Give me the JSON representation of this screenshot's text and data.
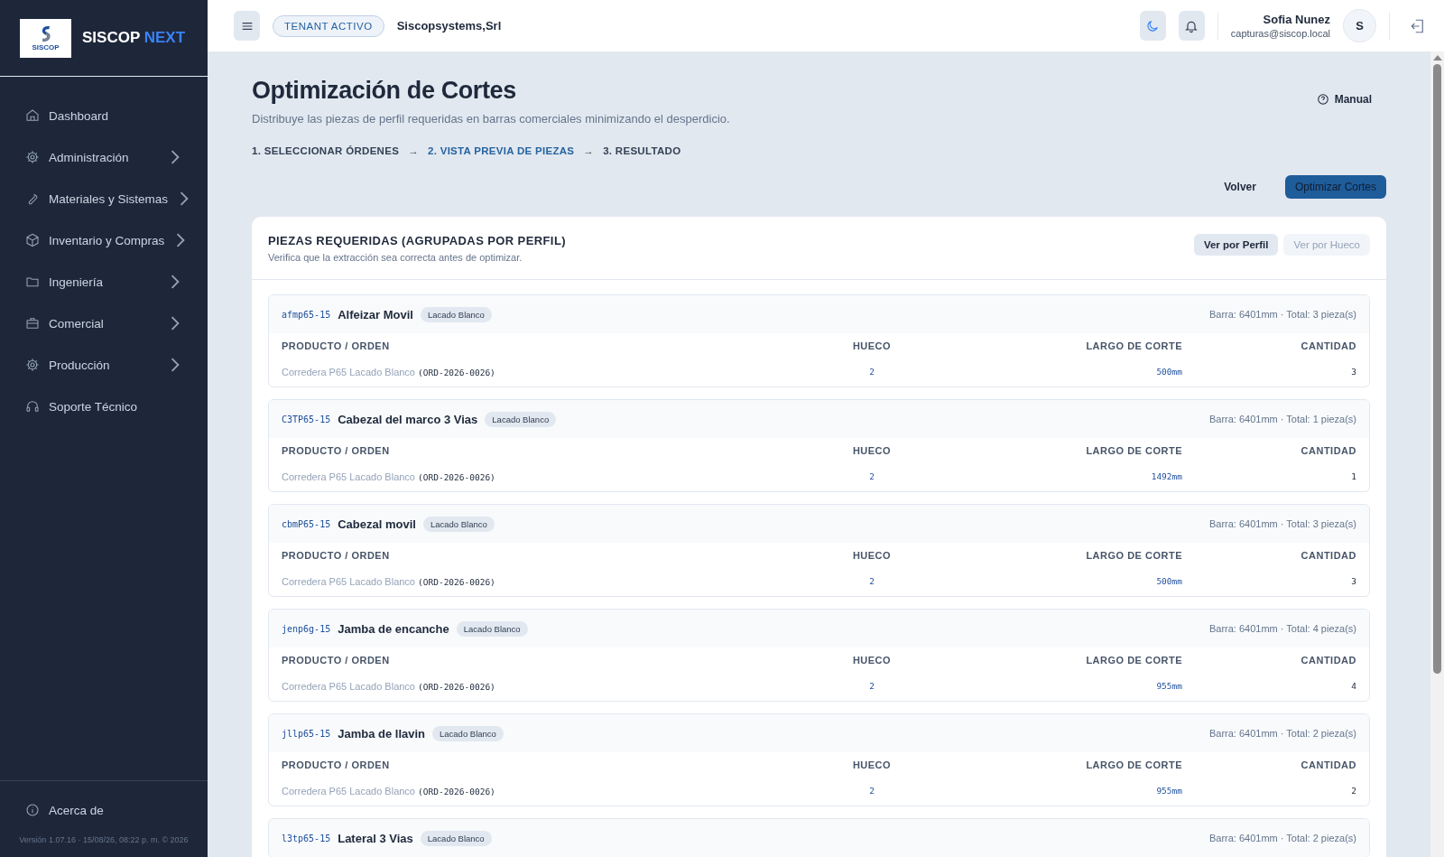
{
  "sidebar": {
    "logo_text": "SISCOP",
    "logo_accent": "NEXT",
    "logo_caption": "SISCOP",
    "items": [
      {
        "label": "Dashboard",
        "submenu": false
      },
      {
        "label": "Administración",
        "submenu": true
      },
      {
        "label": "Materiales y Sistemas",
        "submenu": true
      },
      {
        "label": "Inventario y Compras",
        "submenu": true
      },
      {
        "label": "Ingeniería",
        "submenu": true
      },
      {
        "label": "Comercial",
        "submenu": true
      },
      {
        "label": "Producción",
        "submenu": true
      },
      {
        "label": "Soporte Técnico",
        "submenu": false
      }
    ],
    "footer_item": {
      "label": "Acerca de"
    },
    "version": "Versión 1.07.16 · 15/08/26, 08:22 p. m. © 2026"
  },
  "header": {
    "tenant_badge": "TENANT ACTIVO",
    "tenant_name": "Siscopsystems,Srl",
    "user_name": "Sofia Nunez",
    "user_email": "capturas@siscop.local",
    "avatar": "S"
  },
  "page": {
    "title": "Optimización de Cortes",
    "subtitle": "Distribuye las piezas de perfil requeridas en barras comerciales minimizando el desperdicio.",
    "manual": "Manual",
    "steps": [
      {
        "label": "1. SELECCIONAR ÓRDENES",
        "selected": false
      },
      {
        "label": "2. VISTA PREVIA DE PIEZAS",
        "selected": true
      },
      {
        "label": "3. RESULTADO",
        "selected": false
      }
    ],
    "step_separators": [
      "→",
      "→"
    ],
    "back_button": "Volver",
    "primary_button": "Optimizar Cortes"
  },
  "card": {
    "title": "PIEZAS REQUERIDAS (AGRUPADAS POR PERFIL)",
    "subtitle": "Verifica que la extracción sea correcta antes de optimizar.",
    "view_toggle": [
      {
        "label": "Ver por Perfil",
        "selected": true
      },
      {
        "label": "Ver por Hueco",
        "selected": false
      }
    ],
    "groups": [
      {
        "code": "afmp65-15",
        "name": "Alfeizar Movil",
        "tag": "Lacado Blanco",
        "summary": "Barra: 6401mm · Total: 3 pieza(s)",
        "columns": [
          "PRODUCTO / ORDEN",
          "HUECO",
          "LARGO DE CORTE",
          "CANTIDAD"
        ],
        "rows": [
          {
            "product": "Corredera P65 Lacado Blanco",
            "order": "(ORD-2026-0026)",
            "hueco": "2",
            "largo": "500mm",
            "cantidad": "3"
          }
        ]
      },
      {
        "code": "C3TP65-15",
        "name": "Cabezal del marco 3 Vias",
        "tag": "Lacado Blanco",
        "summary": "Barra: 6401mm · Total: 1 pieza(s)",
        "columns": [
          "PRODUCTO / ORDEN",
          "HUECO",
          "LARGO DE CORTE",
          "CANTIDAD"
        ],
        "rows": [
          {
            "product": "Corredera P65 Lacado Blanco",
            "order": "(ORD-2026-0026)",
            "hueco": "2",
            "largo": "1492mm",
            "cantidad": "1"
          }
        ]
      },
      {
        "code": "cbmP65-15",
        "name": "Cabezal movil",
        "tag": "Lacado Blanco",
        "summary": "Barra: 6401mm · Total: 3 pieza(s)",
        "columns": [
          "PRODUCTO / ORDEN",
          "HUECO",
          "LARGO DE CORTE",
          "CANTIDAD"
        ],
        "rows": [
          {
            "product": "Corredera P65 Lacado Blanco",
            "order": "(ORD-2026-0026)",
            "hueco": "2",
            "largo": "500mm",
            "cantidad": "3"
          }
        ]
      },
      {
        "code": "jenp6g-15",
        "name": "Jamba de encanche",
        "tag": "Lacado Blanco",
        "summary": "Barra: 6401mm · Total: 4 pieza(s)",
        "columns": [
          "PRODUCTO / ORDEN",
          "HUECO",
          "LARGO DE CORTE",
          "CANTIDAD"
        ],
        "rows": [
          {
            "product": "Corredera P65 Lacado Blanco",
            "order": "(ORD-2026-0026)",
            "hueco": "2",
            "largo": "955mm",
            "cantidad": "4"
          }
        ]
      },
      {
        "code": "jllp65-15",
        "name": "Jamba de llavin",
        "tag": "Lacado Blanco",
        "summary": "Barra: 6401mm · Total: 2 pieza(s)",
        "columns": [
          "PRODUCTO / ORDEN",
          "HUECO",
          "LARGO DE CORTE",
          "CANTIDAD"
        ],
        "rows": [
          {
            "product": "Corredera P65 Lacado Blanco",
            "order": "(ORD-2026-0026)",
            "hueco": "2",
            "largo": "955mm",
            "cantidad": "2"
          }
        ]
      },
      {
        "code": "l3tp65-15",
        "name": "Lateral 3 Vias",
        "tag": "Lacado Blanco",
        "summary": "Barra: 6401mm · Total: 2 pieza(s)"
      }
    ]
  }
}
